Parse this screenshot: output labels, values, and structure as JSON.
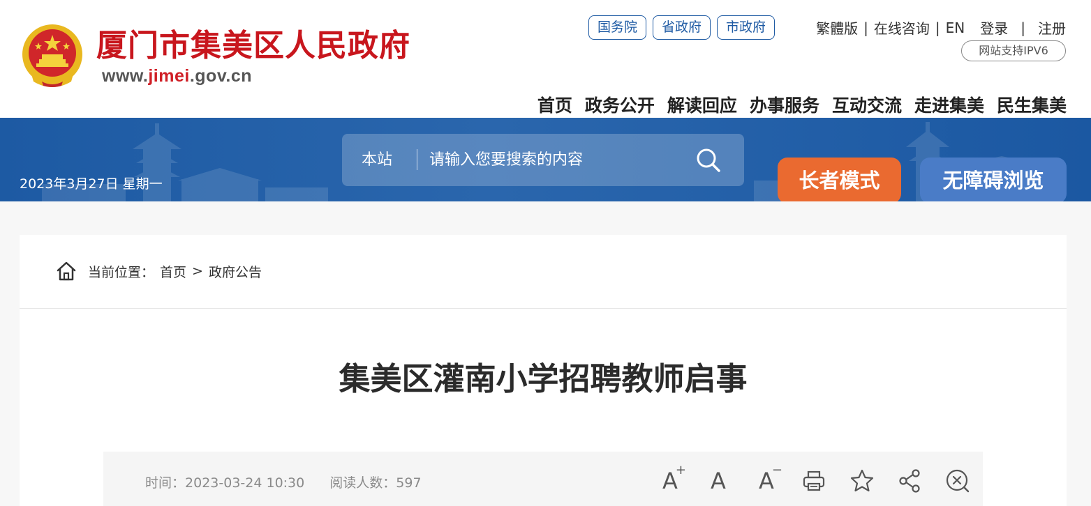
{
  "header": {
    "site_name": "厦门市集美区人民政府",
    "site_url_pre": "www.",
    "site_url_highlight": "jimei",
    "site_url_post": ".gov.cn",
    "gov_links": [
      "国务院",
      "省政府",
      "市政府"
    ],
    "util_links": {
      "traditional": "繁體版",
      "consult": "在线咨询",
      "english": "EN",
      "login": "登录",
      "register": "注册"
    },
    "ipv6": "网站支持IPV6",
    "nav": [
      "首页",
      "政务公开",
      "解读回应",
      "办事服务",
      "互动交流",
      "走进集美",
      "民生集美"
    ]
  },
  "banner": {
    "date": "2023年3月27日 星期一",
    "search_scope": "本站",
    "search_placeholder": "请输入您要搜索的内容",
    "elder_mode": "长者模式",
    "accessible_mode": "无障碍浏览"
  },
  "breadcrumb": {
    "label": "当前位置：",
    "items": [
      "首页",
      "政府公告"
    ],
    "separator": ">"
  },
  "article": {
    "title": "集美区灌南小学招聘教师启事",
    "time_label": "时间：",
    "time_value": "2023-03-24 10:30",
    "views_label": "阅读人数：",
    "views_value": "597"
  },
  "icons": {
    "font_increase": "font-increase-icon",
    "font_reset": "font-reset-icon",
    "font_decrease": "font-decrease-icon",
    "print": "print-icon",
    "favorite": "star-icon",
    "share": "share-icon",
    "close": "close-icon"
  },
  "colors": {
    "brand_red": "#c8161d",
    "banner_blue": "#1d5aa3",
    "elder_orange": "#ea6a30",
    "access_blue": "#4a7cc7"
  }
}
